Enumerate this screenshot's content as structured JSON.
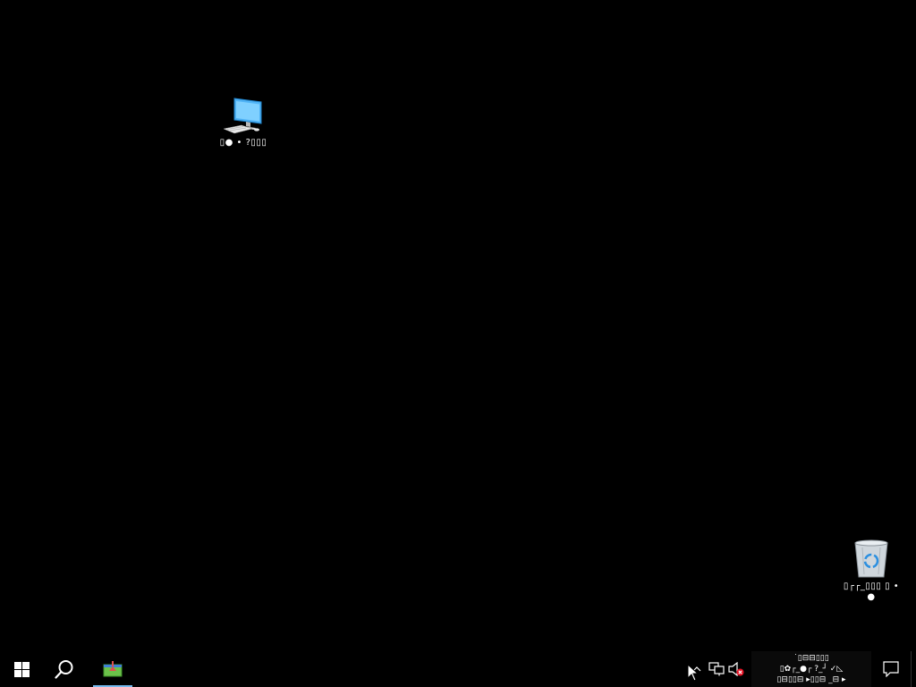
{
  "desktop": {
    "background_color": "#000000",
    "icons": [
      {
        "name": "computer",
        "label": "▯● • ?▯▯▯",
        "icon": "computer-icon"
      },
      {
        "name": "recycle-bin",
        "label": "▯┌┌_▯▯▯ ▯ • ●",
        "icon": "recycle-bin-icon"
      }
    ]
  },
  "taskbar": {
    "background_color": "#000000",
    "start": {
      "icon": "windows-logo-icon"
    },
    "search": {
      "icon": "search-icon"
    },
    "pinned_apps": [
      {
        "name": "app",
        "icon": "app-window-icon",
        "active": true,
        "indicator_color": "#76b9ed"
      }
    ],
    "tray": {
      "icons": [
        {
          "name": "show-hidden",
          "icon": "chevron-up-icon"
        },
        {
          "name": "network",
          "icon": "network-icon"
        },
        {
          "name": "volume",
          "icon": "volume-muted-icon"
        }
      ],
      "clock_line1": "˙▯⊟⊟▯▯▯",
      "clock_line2": "▯✿┌_●┌ ?_┘ ✓◺",
      "clock_line3": "▯⊟▯▯⊟ ▸▯▯⊟ _⊟ ▸",
      "notification": {
        "icon": "action-center-icon"
      }
    }
  }
}
